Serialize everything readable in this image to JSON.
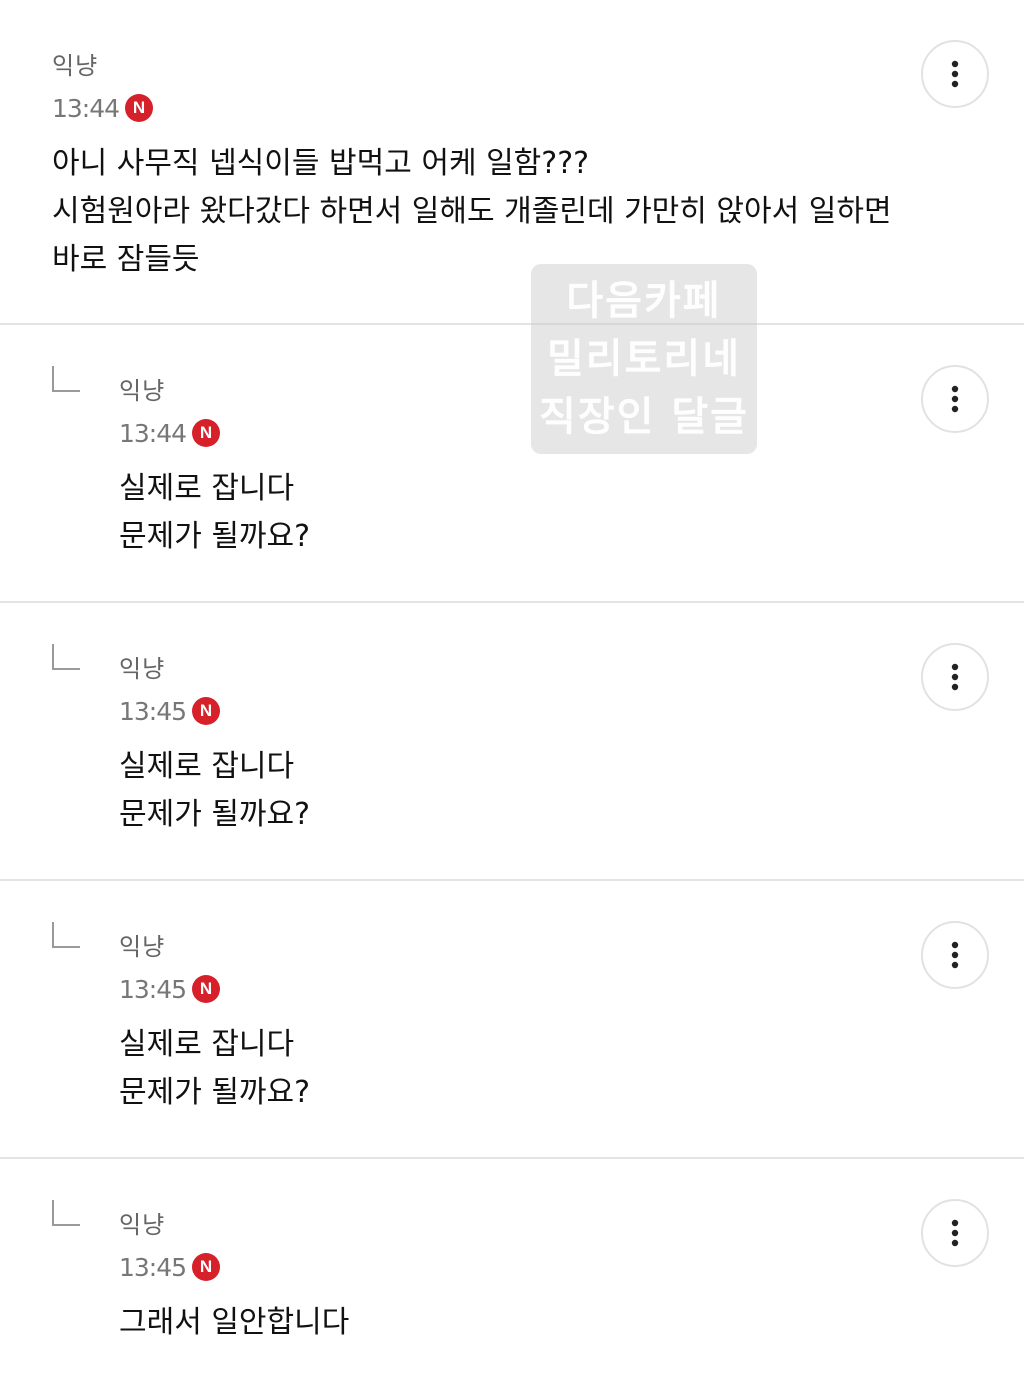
{
  "comments": [
    {
      "author": "익냥",
      "time": "13:44",
      "badge": "N",
      "lines": [
        "아니 사무직 넵식이들 밥먹고 어케 일함???",
        "시험원아라 왔다갔다 하면서 일해도 개졸린데 가만히 앉아서 일하면",
        "바로 잠들듯"
      ]
    },
    {
      "author": "익냥",
      "time": "13:44",
      "badge": "N",
      "lines": [
        "실제로 잡니다",
        "문제가 될까요?"
      ]
    },
    {
      "author": "익냥",
      "time": "13:45",
      "badge": "N",
      "lines": [
        "실제로 잡니다",
        "문제가 될까요?"
      ]
    },
    {
      "author": "익냥",
      "time": "13:45",
      "badge": "N",
      "lines": [
        "실제로 잡니다",
        "문제가 될까요?"
      ]
    },
    {
      "author": "익냥",
      "time": "13:45",
      "badge": "N",
      "lines": [
        "그래서 일안합니다"
      ]
    }
  ],
  "watermark": [
    "다음카페",
    "밀리토리네",
    "직장인 달글"
  ],
  "colors": {
    "badge": "#d6212b",
    "divider": "#e4e4e4"
  },
  "icons": {
    "more": "more-vertical-icon",
    "reply": "reply-arrow-icon"
  }
}
